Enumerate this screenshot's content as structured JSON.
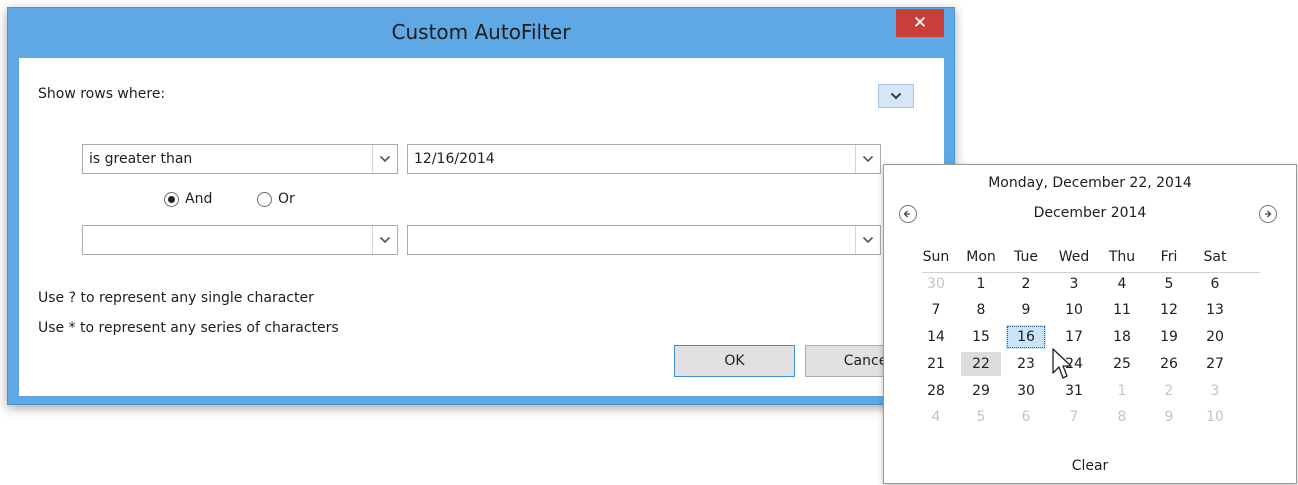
{
  "dialog": {
    "title": "Custom AutoFilter",
    "close_glyph": "✕",
    "show_rows_label": "Show rows where:",
    "condition1": {
      "operator": "is greater than",
      "value": "12/16/2014"
    },
    "logic": {
      "and_label": "And",
      "or_label": "Or",
      "selected": "And"
    },
    "condition2": {
      "operator": "",
      "value": ""
    },
    "hint1": "Use ? to represent any single character",
    "hint2": "Use * to represent any series of characters",
    "ok_label": "OK",
    "cancel_label": "Cancel"
  },
  "calendar": {
    "header_date": "Monday, December 22, 2014",
    "month_label": "December 2014",
    "weekdays": [
      "Sun",
      "Mon",
      "Tue",
      "Wed",
      "Thu",
      "Fri",
      "Sat"
    ],
    "weeks": [
      [
        "30",
        "1",
        "2",
        "3",
        "4",
        "5",
        "6"
      ],
      [
        "7",
        "8",
        "9",
        "10",
        "11",
        "12",
        "13"
      ],
      [
        "14",
        "15",
        "16",
        "17",
        "18",
        "19",
        "20"
      ],
      [
        "21",
        "22",
        "23",
        "24",
        "25",
        "26",
        "27"
      ],
      [
        "28",
        "29",
        "30",
        "31",
        "1",
        "2",
        "3"
      ],
      [
        "4",
        "5",
        "6",
        "7",
        "8",
        "9",
        "10"
      ]
    ],
    "selected_day": "16",
    "today_day": "22",
    "clear_label": "Clear"
  },
  "colors": {
    "titlebar": "#5ea8e5",
    "close_button": "#c9403a",
    "selected_day_bg": "#cbe3f6",
    "today_bg": "#dcdcdc"
  },
  "icons": {
    "close": "close-icon",
    "dropdown": "chevron-down-icon",
    "prev_month": "arrow-left-circle-icon",
    "next_month": "arrow-right-circle-icon",
    "cursor": "mouse-pointer-icon"
  }
}
